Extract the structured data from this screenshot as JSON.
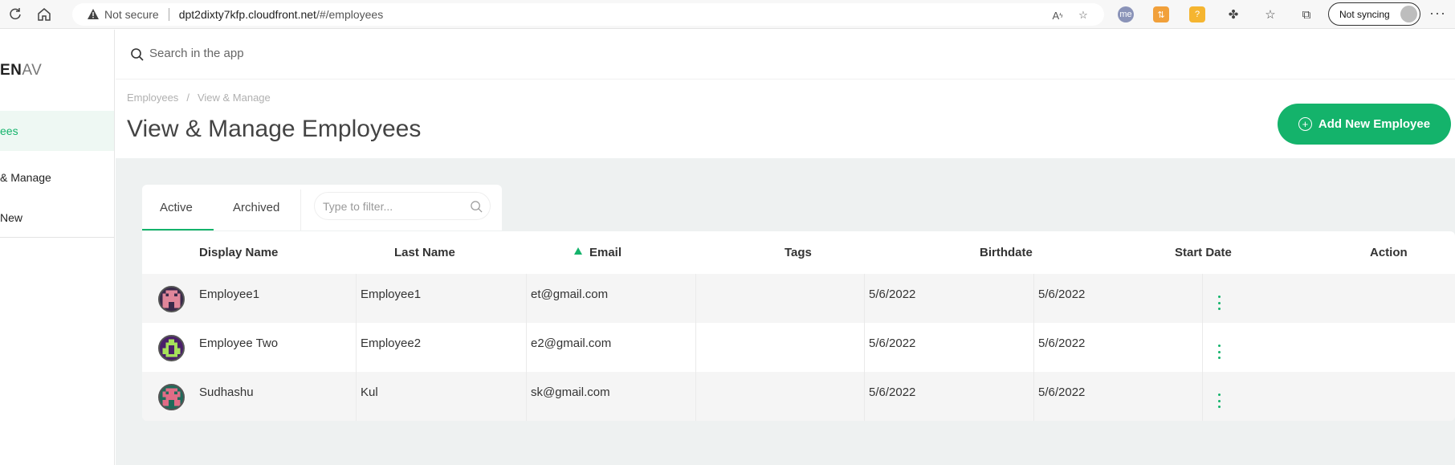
{
  "browser": {
    "security": "Not secure",
    "url_host": "dpt2dixty7kfp.cloudfront.net",
    "url_path": "/#/employees",
    "sync_label": "Not syncing"
  },
  "sidebar": {
    "logo_bold": "EN",
    "logo_thin": "AV",
    "items": [
      {
        "label": "ees",
        "active": true
      },
      {
        "label": "& Manage",
        "active": false
      },
      {
        "label": "New",
        "active": false
      }
    ]
  },
  "search": {
    "placeholder": "Search in the app"
  },
  "header": {
    "breadcrumb": [
      "Employees",
      "View & Manage"
    ],
    "breadcrumb_sep": "/",
    "title": "View & Manage Employees",
    "add_button": "Add New Employee"
  },
  "tabs": [
    {
      "label": "Active",
      "active": true
    },
    {
      "label": "Archived",
      "active": false
    }
  ],
  "filter": {
    "placeholder": "Type to filter..."
  },
  "table": {
    "columns": [
      "Display Name",
      "Last Name",
      "Email",
      "Tags",
      "Birthdate",
      "Start Date",
      "Action"
    ],
    "sorted_column": "Email",
    "rows": [
      {
        "display_name": "Employee1",
        "last_name": "Employee1",
        "email": "et@gmail.com",
        "tags": "",
        "birthdate": "5/6/2022",
        "start_date": "5/6/2022",
        "avatar_color": "#e0869a"
      },
      {
        "display_name": "Employee Two",
        "last_name": "Employee2",
        "email": "e2@gmail.com",
        "tags": "",
        "birthdate": "5/6/2022",
        "start_date": "5/6/2022",
        "avatar_color": "#a6e05a"
      },
      {
        "display_name": "Sudhashu",
        "last_name": "Kul",
        "email": "sk@gmail.com",
        "tags": "",
        "birthdate": "5/6/2022",
        "start_date": "5/6/2022",
        "avatar_color": "#e06c86"
      }
    ]
  },
  "colors": {
    "accent": "#14b36b",
    "content_bg": "#eef1f1"
  }
}
